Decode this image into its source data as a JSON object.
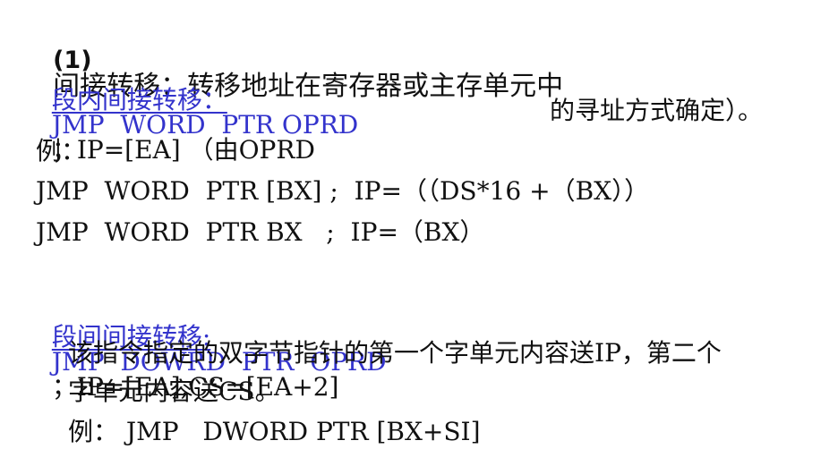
{
  "title": {
    "number": "(1)",
    "text": "间接转移：转移地址在寄存器或主存单元中"
  },
  "intra_segment": {
    "heading": "段内间接转移：",
    "instruction": "JMP  WORD  PTR OPRD",
    "description_1": "；IP=[EA] （由OPRD",
    "description_2": "的寻址方式确定）。"
  },
  "examples_label": "例：",
  "examples": [
    "JMP  WORD  PTR [BX] ;  IP=（（DS*16 +（BX））",
    "JMP  WORD  PTR BX   ;  IP=（BX）"
  ],
  "inter_segment": {
    "heading": "段间间接转移:",
    "instruction": "JMP  DOWRD  PTR  OPRD",
    "description": "；IP=[EA],CS=[EA+2]",
    "explanation_1": "该指令指定的双字节指针的第一个字单元内容送IP，第二个",
    "explanation_2": "字单元内容送CS。",
    "example": "例： JMP   DWORD PTR [BX+SI]"
  }
}
